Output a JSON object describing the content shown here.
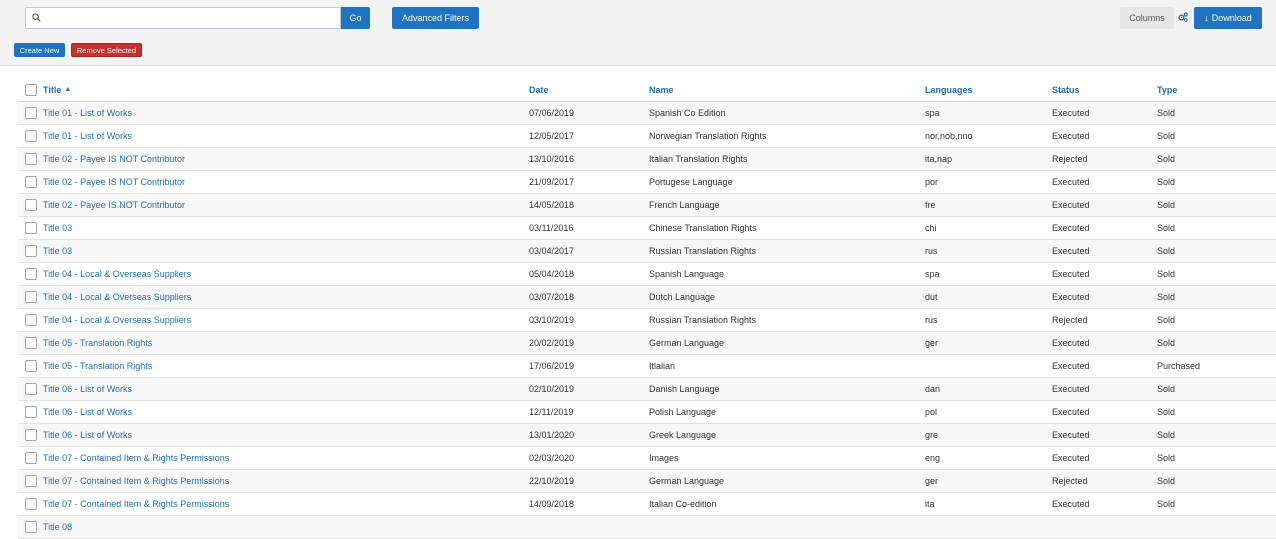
{
  "toolbar": {
    "search_placeholder": "",
    "go_label": "Go",
    "advanced_filters_label": "Advanced Filters",
    "create_new_label": "Create New",
    "remove_selected_label": "Remove Selected",
    "columns_label": "Columns",
    "download_label": "Download"
  },
  "colors": {
    "accent": "#1e74c2",
    "danger": "#c9302c",
    "link": "#1e6fb8"
  },
  "table": {
    "headers": {
      "title": "Title",
      "title_sort": "▲",
      "date": "Date",
      "name": "Name",
      "languages": "Languages",
      "status": "Status",
      "type": "Type"
    },
    "rows": [
      {
        "title": "Title 01 - List of Works",
        "date": "07/06/2019",
        "name": "Spanish Co Edition",
        "languages": "spa",
        "status": "Executed",
        "type": "Sold"
      },
      {
        "title": "Title 01 - List of Works",
        "date": "12/05/2017",
        "name": "Norwegian Translation Rights",
        "languages": "nor,nob,nno",
        "status": "Executed",
        "type": "Sold"
      },
      {
        "title": "Title 02 - Payee IS NOT Contributor",
        "date": "13/10/2016",
        "name": "Italian Translation Rights",
        "languages": "ita,nap",
        "status": "Rejected",
        "type": "Sold"
      },
      {
        "title": "Title 02 - Payee IS NOT Contributor",
        "date": "21/09/2017",
        "name": "Portugese Language",
        "languages": "por",
        "status": "Executed",
        "type": "Sold"
      },
      {
        "title": "Title 02 - Payee IS NOT Contributor",
        "date": "14/05/2018",
        "name": "French Language",
        "languages": "fre",
        "status": "Executed",
        "type": "Sold"
      },
      {
        "title": "Title 03",
        "date": "03/11/2016",
        "name": "Chinese Translation Rights",
        "languages": "chi",
        "status": "Executed",
        "type": "Sold"
      },
      {
        "title": "Title 03",
        "date": "03/04/2017",
        "name": "Russian Translation Rights",
        "languages": "rus",
        "status": "Executed",
        "type": "Sold"
      },
      {
        "title": "Title 04 - Local & Overseas Suppliers",
        "date": "05/04/2018",
        "name": "Spanish Language",
        "languages": "spa",
        "status": "Executed",
        "type": "Sold"
      },
      {
        "title": "Title 04 - Local & Overseas Suppliers",
        "date": "03/07/2018",
        "name": "Dutch Language",
        "languages": "dut",
        "status": "Executed",
        "type": "Sold"
      },
      {
        "title": "Title 04 - Local & Overseas Suppliers",
        "date": "03/10/2019",
        "name": "Russian Translation Rights",
        "languages": "rus",
        "status": "Rejected",
        "type": "Sold"
      },
      {
        "title": "Title 05 - Translation Rights",
        "date": "20/02/2019",
        "name": "German Language",
        "languages": "ger",
        "status": "Executed",
        "type": "Sold"
      },
      {
        "title": "Title 05 - Translation Rights",
        "date": "17/06/2019",
        "name": "Itlalian",
        "languages": "",
        "status": "Executed",
        "type": "Purchased"
      },
      {
        "title": "Title 06 - List of Works",
        "date": "02/10/2019",
        "name": "Danish Language",
        "languages": "dan",
        "status": "Executed",
        "type": "Sold"
      },
      {
        "title": "Title 06 - List of Works",
        "date": "12/11/2019",
        "name": "Polish Language",
        "languages": "pol",
        "status": "Executed",
        "type": "Sold"
      },
      {
        "title": "Title 06 - List of Works",
        "date": "13/01/2020",
        "name": "Greek Language",
        "languages": "gre",
        "status": "Executed",
        "type": "Sold"
      },
      {
        "title": "Title 07 - Contained Item & Rights Permissions",
        "date": "02/03/2020",
        "name": "Images",
        "languages": "eng",
        "status": "Executed",
        "type": "Sold"
      },
      {
        "title": "Title 07 - Contained Item & Rights Permissions",
        "date": "22/10/2019",
        "name": "German Language",
        "languages": "ger",
        "status": "Rejected",
        "type": "Sold"
      },
      {
        "title": "Title 07 - Contained Item & Rights Permissions",
        "date": "14/09/2018",
        "name": "Italian Co-edition",
        "languages": "ita",
        "status": "Executed",
        "type": "Sold"
      },
      {
        "title": "Title 08",
        "date": "",
        "name": "",
        "languages": "",
        "status": "",
        "type": ""
      }
    ]
  }
}
